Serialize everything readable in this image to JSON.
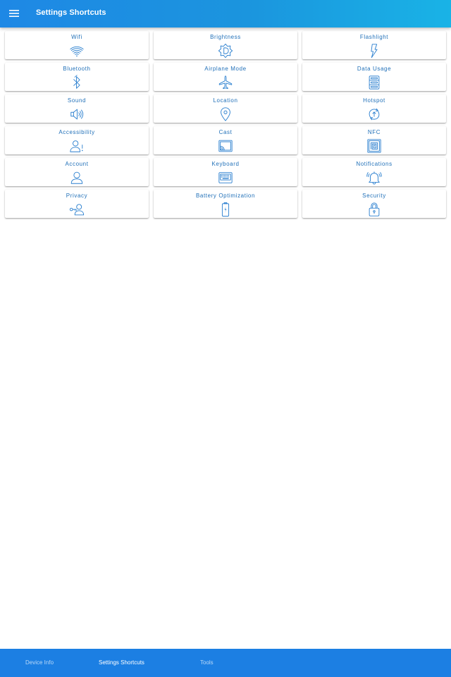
{
  "app_bar": {
    "title": "Settings Shortcuts",
    "menu_icon": "menu-icon",
    "colors": {
      "start": "#1e88e5",
      "end": "#19b3e6"
    }
  },
  "tiles": [
    {
      "label": "Wifi",
      "icon": "wifi-icon"
    },
    {
      "label": "Brightness",
      "icon": "brightness-icon"
    },
    {
      "label": "Flashlight",
      "icon": "flashlight-icon"
    },
    {
      "label": "Bluetooth",
      "icon": "bluetooth-icon"
    },
    {
      "label": "Airplane Mode",
      "icon": "airplane-icon"
    },
    {
      "label": "Data Usage",
      "icon": "data-usage-icon"
    },
    {
      "label": "Sound",
      "icon": "speaker-icon"
    },
    {
      "label": "Location",
      "icon": "location-pin-icon"
    },
    {
      "label": "Hotspot",
      "icon": "hotspot-icon"
    },
    {
      "label": "Accessibility",
      "icon": "accessibility-icon"
    },
    {
      "label": "Cast",
      "icon": "cast-icon"
    },
    {
      "label": "NFC",
      "icon": "nfc-icon"
    },
    {
      "label": "Account",
      "icon": "account-icon"
    },
    {
      "label": "Keyboard",
      "icon": "keyboard-icon"
    },
    {
      "label": "Notifications",
      "icon": "notification-bell-icon"
    },
    {
      "label": "Privacy",
      "icon": "privacy-icon"
    },
    {
      "label": "Battery Optimization",
      "icon": "battery-icon"
    },
    {
      "label": "Security",
      "icon": "lock-icon"
    }
  ],
  "bottom_nav": {
    "items": [
      {
        "label": "Device Info",
        "active": false
      },
      {
        "label": "Settings Shortcuts",
        "active": true
      },
      {
        "label": "Tools",
        "active": false
      }
    ]
  },
  "colors": {
    "accent": "#1c7fe3",
    "tile_text": "#1f6fb8",
    "icon_stroke": "#2a7fcf"
  }
}
